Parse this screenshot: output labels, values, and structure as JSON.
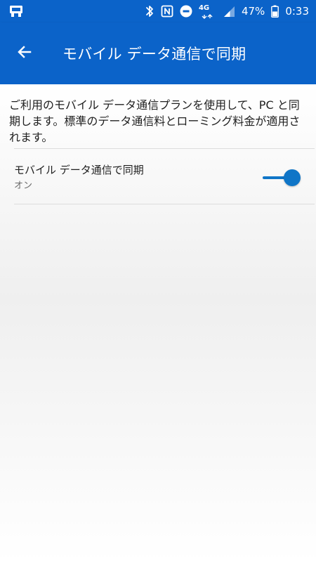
{
  "status_bar": {
    "network_type": "4G",
    "battery_percent": "47%",
    "clock": "0:33",
    "icons": [
      "notification-icon",
      "bluetooth-icon",
      "nfc-icon",
      "do-not-disturb-icon",
      "lte-icon",
      "signal-icon",
      "battery-icon"
    ]
  },
  "app_bar": {
    "back_icon": "arrow-left-icon",
    "title": "モバイル データ通信で同期"
  },
  "content": {
    "description": "ご利用のモバイル データ通信プランを使用して、PC と同期します。標準のデータ通信料とローミング料金が適用されます。",
    "setting": {
      "title": "モバイル データ通信で同期",
      "status": "オン",
      "enabled": true
    }
  },
  "colors": {
    "primary": "#0b63c9",
    "accent": "#0f75c7",
    "text_primary": "#1f1f1f",
    "text_secondary": "#6a6a6a"
  }
}
